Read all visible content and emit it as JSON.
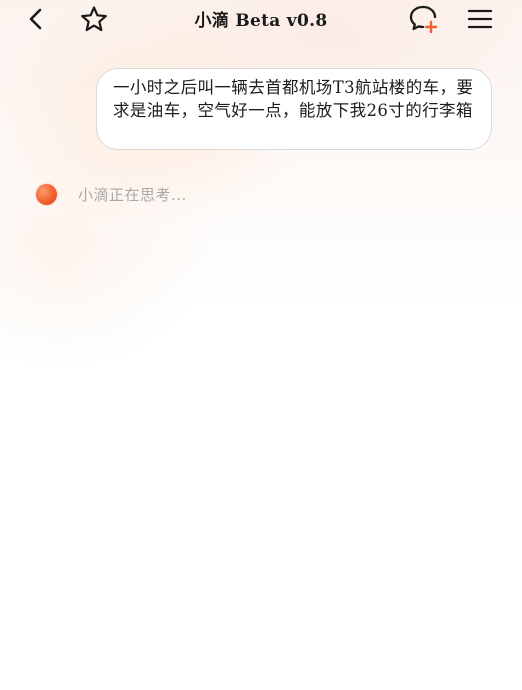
{
  "header": {
    "title": "小滴 Beta v0.8",
    "icons": {
      "back": "chevron-left-icon",
      "favorite": "star-icon",
      "new_chat": "chat-add-icon",
      "menu": "menu-icon"
    }
  },
  "conversation": {
    "user_message": "一小时之后叫一辆去首都机场T3航站楼的车，要求是油车，空气好一点，能放下我26寸的行李箱",
    "assistant_status": "小滴正在思考..."
  },
  "colors": {
    "accent": "#f2602f",
    "status_text": "#a9a9a9"
  }
}
